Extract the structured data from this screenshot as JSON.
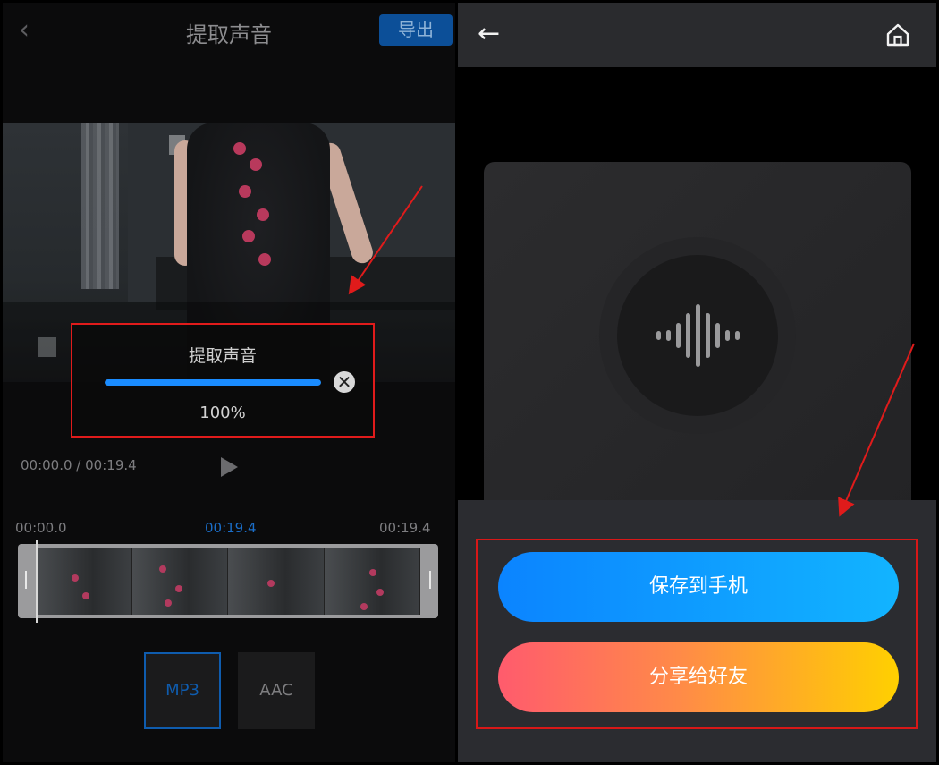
{
  "left": {
    "header": {
      "back_icon": "chevron-left-icon",
      "title": "提取声音",
      "export_label": "导出"
    },
    "dialog": {
      "title": "提取声音",
      "progress": 1.0,
      "percent_text": "100%",
      "close_icon": "close-circle-icon"
    },
    "player": {
      "time_display": "00:00.0 / 00:19.4",
      "play_icon": "play-icon"
    },
    "timeline": {
      "start": "00:00.0",
      "current": "00:19.4",
      "end": "00:19.4"
    },
    "formats": [
      {
        "label": "MP3",
        "selected": true
      },
      {
        "label": "AAC",
        "selected": false
      }
    ],
    "colors": {
      "accent": "#1b6ec9",
      "annotation": "#e01b1b"
    }
  },
  "right": {
    "topbar": {
      "back_icon": "arrow-left-icon",
      "home_icon": "home-icon"
    },
    "audio_icon": "sound-wave-icon",
    "buttons": {
      "save": "保存到手机",
      "share": "分享给好友"
    },
    "colors": {
      "save_start": "#0b84ff",
      "save_end": "#12b4ff",
      "share_start": "#ff5b6d",
      "share_end": "#ffd000"
    }
  }
}
